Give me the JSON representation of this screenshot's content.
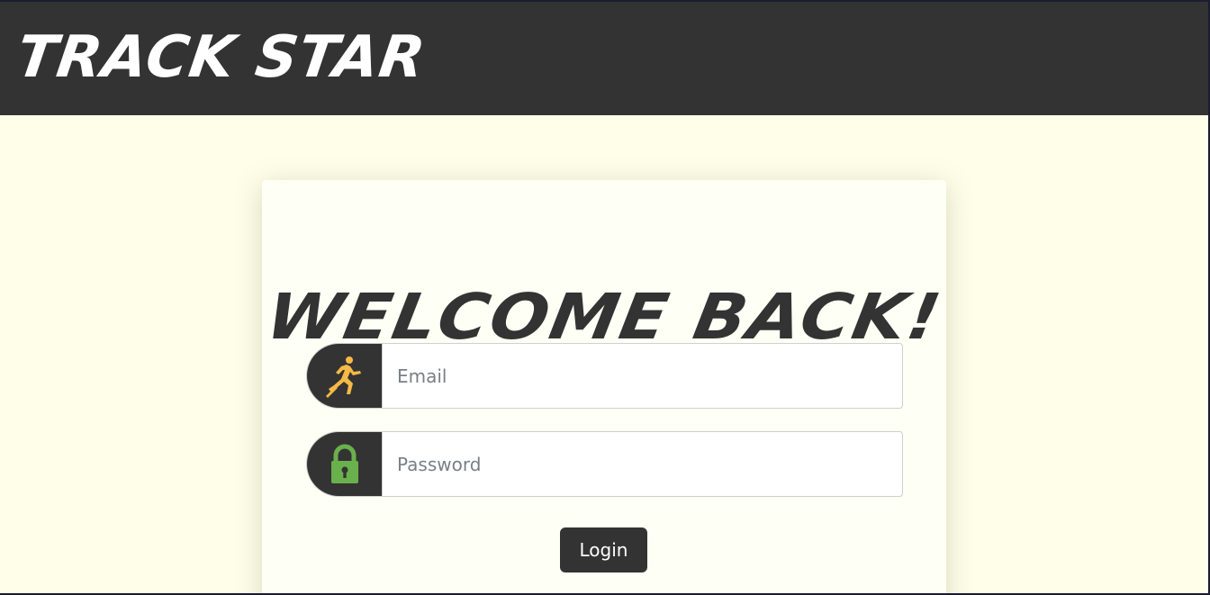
{
  "header": {
    "brand": "TRACK STAR"
  },
  "login": {
    "title": "WELCOME BACK!",
    "email": {
      "placeholder": "Email",
      "icon": "runner-icon",
      "icon_color": "#f5b945"
    },
    "password": {
      "placeholder": "Password",
      "icon": "lock-icon",
      "icon_color": "#6ab04c"
    },
    "submit_label": "Login"
  },
  "colors": {
    "navbar": "#333333",
    "page_background": "#fffee9",
    "card_background": "#fefff5",
    "button": "#333333"
  }
}
